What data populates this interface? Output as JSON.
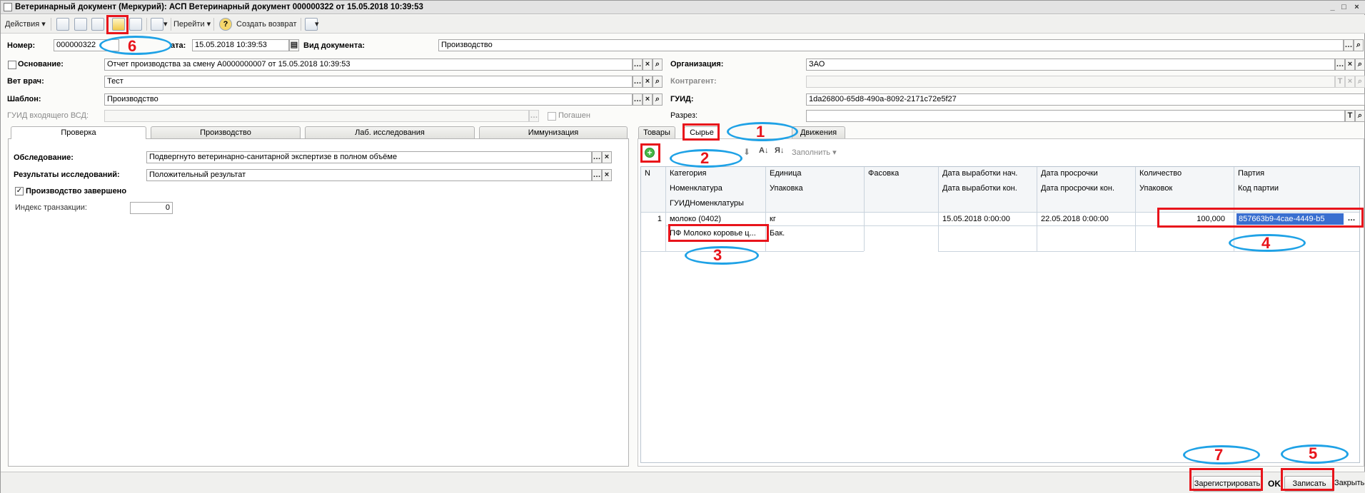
{
  "window": {
    "title": "Ветеринарный документ (Меркурий): АСП Ветеринарный документ 000000322 от 15.05.2018 10:39:53",
    "controls": [
      "_",
      "□",
      "×"
    ]
  },
  "toolbar": {
    "actions_label": "Действия",
    "goto_label": "Перейти",
    "create_return_label": "Создать возврат",
    "help_symbol": "?"
  },
  "header": {
    "number_label": "Номер:",
    "number_value": "000000322",
    "date_label": "ата:",
    "date_value": "15.05.2018 10:39:53",
    "doc_type_label": "Вид документа:",
    "doc_type_value": "Производство"
  },
  "left_fields": {
    "basis_label": "Основание:",
    "basis_value": "Отчет производства за смену А0000000007 от 15.05.2018 10:39:53",
    "vet_label": "Вет врач:",
    "vet_value": "Тест",
    "template_label": "Шаблон:",
    "template_value": "Производство",
    "guid_in_label": "ГУИД входящего ВСД:",
    "guid_in_value": "",
    "repaid_label": "Погашен"
  },
  "right_fields": {
    "org_label": "Организация:",
    "org_value": "ЗАО",
    "counterparty_label": "Контрагент:",
    "counterparty_value": "",
    "guid_label": "ГУИД:",
    "guid_value": "1da26800-65d8-490a-8092-2171c72e5f27",
    "permit_label": "Разрез:",
    "permit_value": ""
  },
  "left_tabs": [
    "Проверка",
    "Производство",
    "Лаб. исследования",
    "Иммунизация"
  ],
  "check_tab": {
    "exam_label": "Обследование:",
    "exam_value": "Подвергнуто ветеринарно-санитарной экспертизе в полном объёме",
    "results_label": "Результаты исследований:",
    "results_value": "Положительный результат",
    "prod_done_label": "Производство завершено",
    "prod_done_checked": "✓",
    "tx_index_label": "Индекс транзакции:",
    "tx_index_value": "0"
  },
  "right_tabs": [
    "Товары",
    "Сырье",
    "Движения"
  ],
  "grid_toolbar": {
    "fill_label": "Заполнить"
  },
  "grid": {
    "headers": [
      [
        "N",
        "",
        ""
      ],
      [
        "Категория",
        "Номенклатура",
        "ГУИДНоменклатуры"
      ],
      [
        "Единица",
        "Упаковка",
        ""
      ],
      [
        "Фасовка",
        "",
        ""
      ],
      [
        "Дата выработки нач.",
        "Дата выработки кон.",
        ""
      ],
      [
        "Дата просрочки",
        "Дата просрочки кон.",
        ""
      ],
      [
        "Количество",
        "Упаковок",
        ""
      ],
      [
        "Партия",
        "Код партии",
        ""
      ]
    ],
    "row": {
      "n": "1",
      "category": "молоко (0402)",
      "nomenclature": "ПФ Молоко коровье ц...",
      "unit": "кг",
      "packaging": "Бак.",
      "date_start": "15.05.2018 0:00:00",
      "expiry": "22.05.2018 0:00:00",
      "quantity": "100,000",
      "batch": "857663b9-4cae-4449-b5"
    }
  },
  "bottom": {
    "register_label": "Зарегистрировать",
    "ok_label": "OK",
    "save_label": "Записать",
    "close_label": "Закрыть"
  },
  "annotations": [
    "1",
    "2",
    "3",
    "4",
    "5",
    "6",
    "7"
  ],
  "colors": {
    "annotation_red": "#e8141b",
    "annotation_blue": "#1fa2e6",
    "selection_blue": "#3a6fd0"
  }
}
